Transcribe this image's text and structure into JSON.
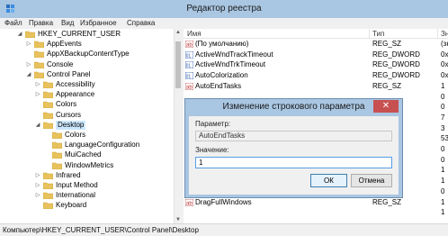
{
  "window": {
    "title": "Редактор реестра"
  },
  "menu": [
    "Файл",
    "Правка",
    "Вид",
    "Избранное",
    "Справка"
  ],
  "tree": [
    {
      "label": "HKEY_CURRENT_USER",
      "exp": "◢"
    },
    {
      "label": "AppEvents",
      "exp": "▷"
    },
    {
      "label": "AppXBackupContentType",
      "exp": ""
    },
    {
      "label": "Console",
      "exp": "▷"
    },
    {
      "label": "Control Panel",
      "exp": "◢"
    },
    {
      "label": "Accessibility",
      "exp": "▷"
    },
    {
      "label": "Appearance",
      "exp": "▷"
    },
    {
      "label": "Colors",
      "exp": ""
    },
    {
      "label": "Cursors",
      "exp": ""
    },
    {
      "label": "Desktop",
      "exp": "◢"
    },
    {
      "label": "Colors",
      "exp": ""
    },
    {
      "label": "LanguageConfiguration",
      "exp": ""
    },
    {
      "label": "MuiCached",
      "exp": ""
    },
    {
      "label": "WindowMetrics",
      "exp": ""
    },
    {
      "label": "Infrared",
      "exp": "▷"
    },
    {
      "label": "Input Method",
      "exp": "▷"
    },
    {
      "label": "International",
      "exp": "▷"
    },
    {
      "label": "Keyboard",
      "exp": ""
    }
  ],
  "list": {
    "columns": [
      "Имя",
      "Тип",
      "Зн"
    ],
    "rows": [
      {
        "name": "(По умолчанию)",
        "type": "REG_SZ",
        "value": "(зн",
        "kind": "sz"
      },
      {
        "name": "ActiveWndTrackTimeout",
        "type": "REG_DWORD",
        "value": "0x",
        "kind": "dword"
      },
      {
        "name": "ActiveWndTrkTimeout",
        "type": "REG_DWORD",
        "value": "0x",
        "kind": "dword"
      },
      {
        "name": "AutoColorization",
        "type": "REG_DWORD",
        "value": "0x",
        "kind": "dword"
      },
      {
        "name": "AutoEndTasks",
        "type": "REG_SZ",
        "value": "1",
        "kind": "sz"
      },
      {
        "name": "",
        "type": "",
        "value": "0",
        "kind": ""
      },
      {
        "name": "",
        "type": "",
        "value": "0",
        "kind": ""
      },
      {
        "name": "",
        "type": "",
        "value": "7",
        "kind": ""
      },
      {
        "name": "",
        "type": "",
        "value": "3",
        "kind": ""
      },
      {
        "name": "",
        "type": "",
        "value": "53",
        "kind": ""
      },
      {
        "name": "",
        "type": "",
        "value": "0",
        "kind": ""
      },
      {
        "name": "",
        "type": "",
        "value": "0",
        "kind": ""
      },
      {
        "name": "",
        "type": "",
        "value": "1",
        "kind": ""
      },
      {
        "name": "",
        "type": "",
        "value": "1",
        "kind": ""
      },
      {
        "name": "",
        "type": "",
        "value": "0",
        "kind": ""
      },
      {
        "name": "DragFullWindows",
        "type": "REG_SZ",
        "value": "1",
        "kind": "sz"
      },
      {
        "name": "",
        "type": "",
        "value": "1",
        "kind": ""
      }
    ]
  },
  "status": "Компьютер\\HKEY_CURRENT_USER\\Control Panel\\Desktop",
  "dialog": {
    "title": "Изменение строкового параметра",
    "close": "✕",
    "name_label": "Параметр:",
    "name_value": "AutoEndTasks",
    "value_label": "Значение:",
    "value": "1",
    "ok": "ОК",
    "cancel": "Отмена"
  }
}
